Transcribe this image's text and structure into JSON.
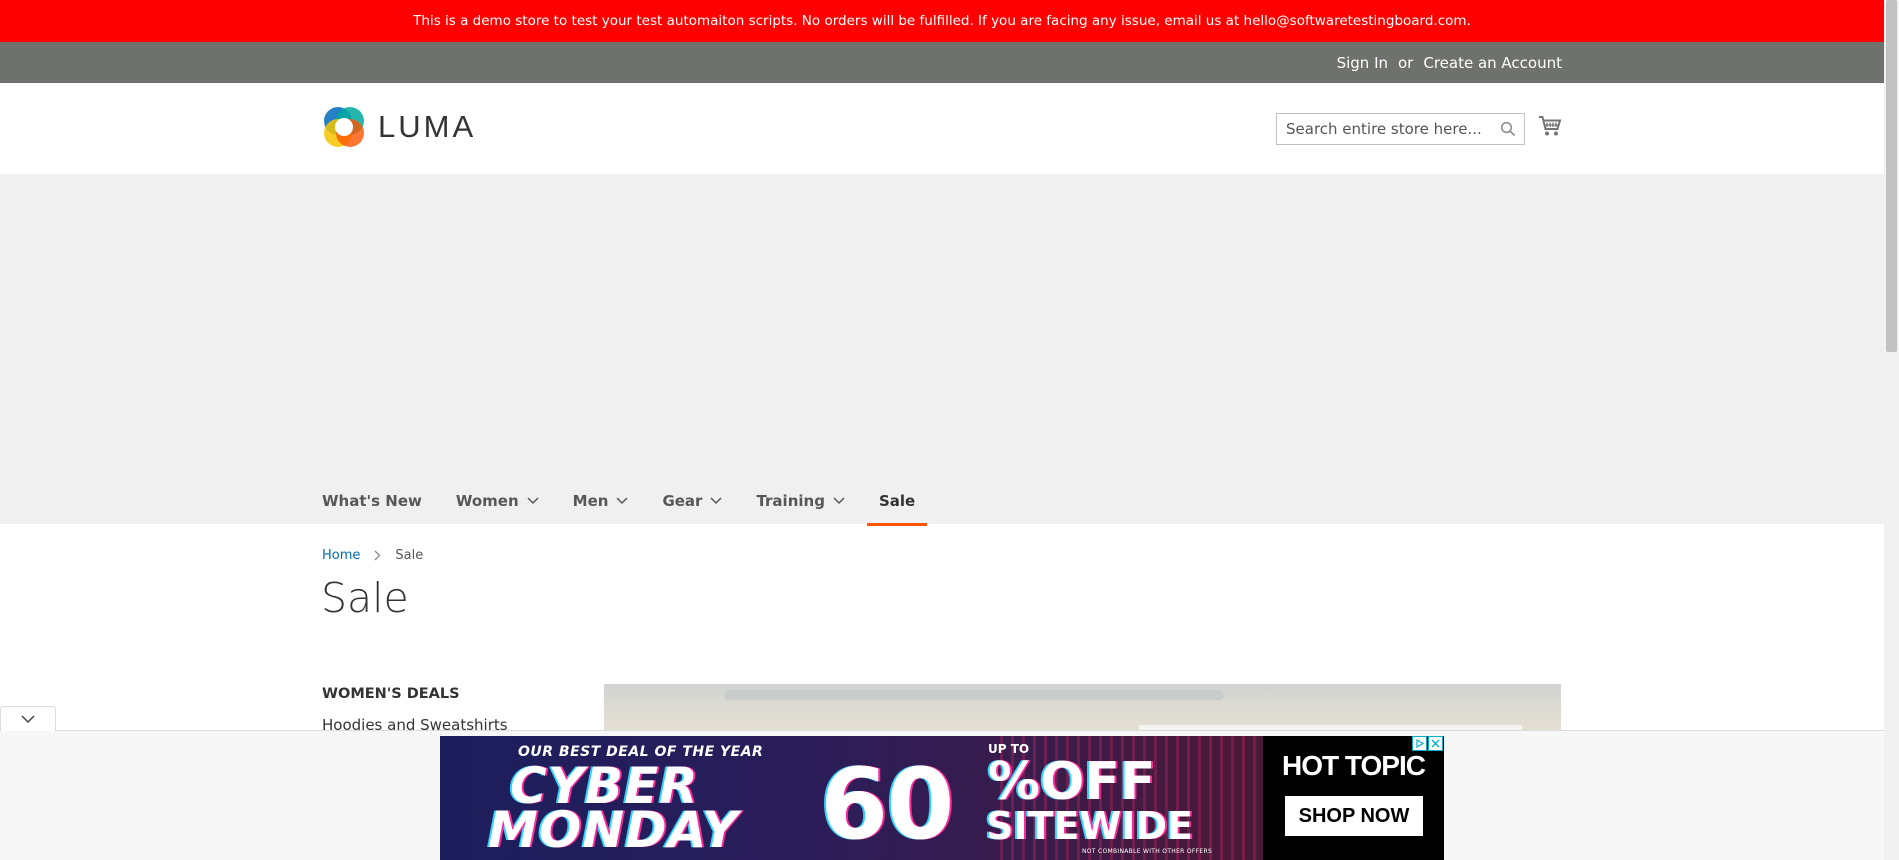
{
  "notice": {
    "text": "This is a demo store to test your test automaiton scripts. No orders will be fulfilled. If you are facing any issue, email us at hello@softwaretestingboard.com."
  },
  "account": {
    "sign_in": "Sign In",
    "or": "or",
    "create_account": "Create an Account"
  },
  "header": {
    "logo_text": "LUMA",
    "search_placeholder": "Search entire store here...",
    "search_icon": "search-icon",
    "cart_icon": "cart-icon"
  },
  "nav": {
    "items": [
      {
        "label": "What's New",
        "has_submenu": false
      },
      {
        "label": "Women",
        "has_submenu": true
      },
      {
        "label": "Men",
        "has_submenu": true
      },
      {
        "label": "Gear",
        "has_submenu": true
      },
      {
        "label": "Training",
        "has_submenu": true
      },
      {
        "label": "Sale",
        "has_submenu": false,
        "active": true
      }
    ],
    "active_underline_color": "#ff5501"
  },
  "breadcrumb": {
    "home": "Home",
    "current": "Sale"
  },
  "page": {
    "title": "Sale"
  },
  "sidebar": {
    "section_title": "WOMEN'S DEALS",
    "links": [
      "Hoodies and Sweatshirts"
    ]
  },
  "ad": {
    "line1": "OUR BEST DEAL OF THE YEAR",
    "cyber": "CYBER",
    "monday": "MONDAY",
    "up_to": "UP TO",
    "percent": "60",
    "percent_off": "%OFF",
    "sitewide": "SITEWIDE",
    "fine_print": "NOT COMBINABLE WITH OTHER OFFERS",
    "brand": "HOT TOPIC",
    "cta": "SHOP NOW"
  },
  "colors": {
    "notice_bg": "#ff0000",
    "account_bar_bg": "#6e716e",
    "nav_bg": "#f0f0f0",
    "link_blue": "#006bb4",
    "accent_orange": "#ff5501"
  }
}
